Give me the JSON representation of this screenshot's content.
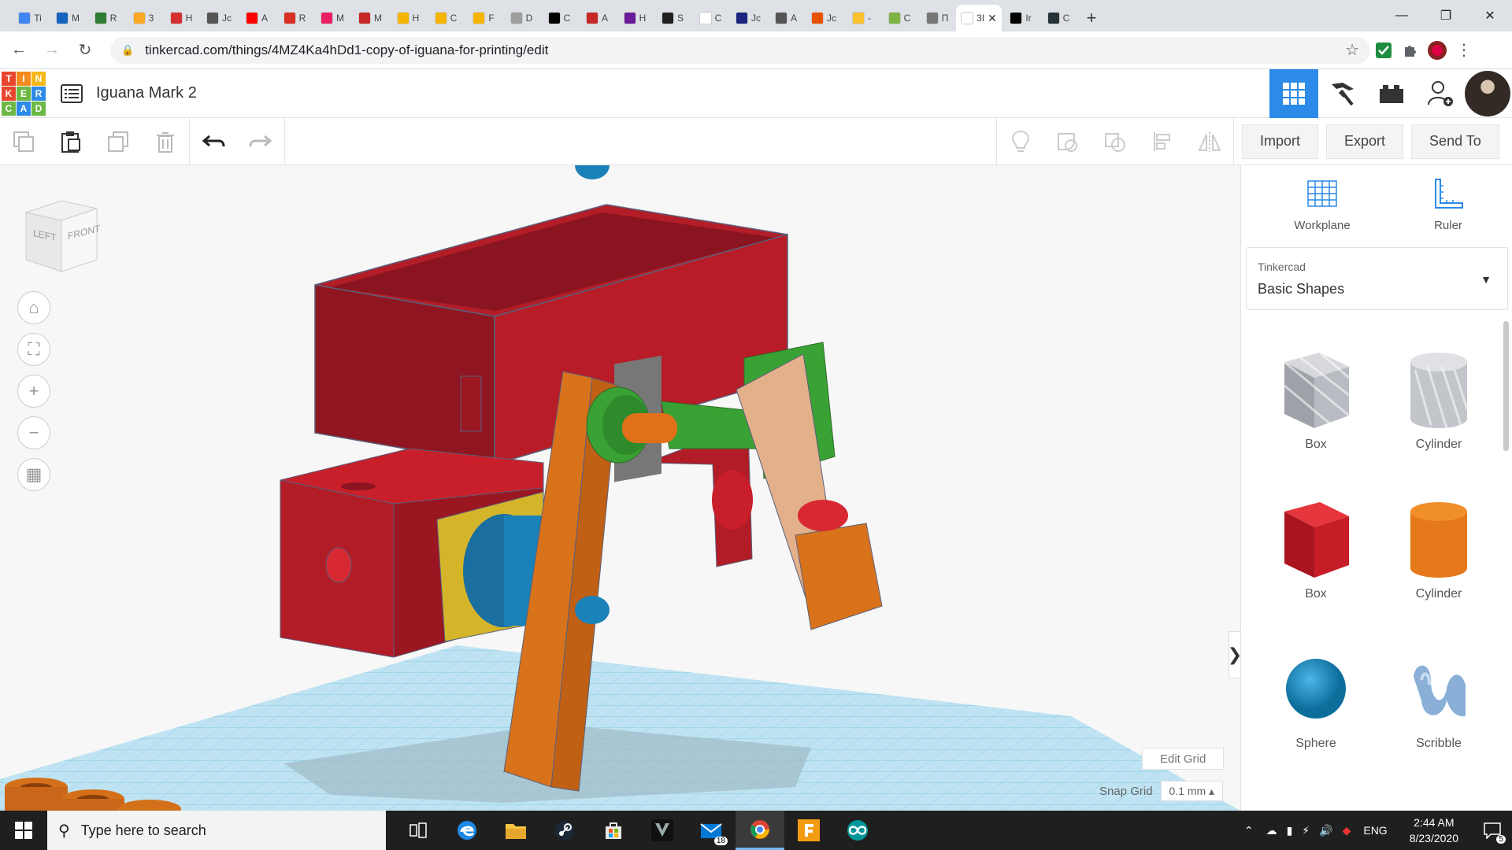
{
  "browser": {
    "tabs": [
      {
        "letter": "Ti",
        "color": "#4285f4"
      },
      {
        "letter": "M",
        "color": "#1565c0"
      },
      {
        "letter": "R",
        "color": "#2e7d32"
      },
      {
        "letter": "3",
        "color": "#f9a825"
      },
      {
        "letter": "H",
        "color": "#d32f2f"
      },
      {
        "letter": "Jc",
        "color": "#555555"
      },
      {
        "letter": "A",
        "color": "#ff0000"
      },
      {
        "letter": "R",
        "color": "#d93025"
      },
      {
        "letter": "M",
        "color": "#e91e63"
      },
      {
        "letter": "M",
        "color": "#c62828"
      },
      {
        "letter": "H",
        "color": "#f4b400"
      },
      {
        "letter": "C",
        "color": "#f4b400"
      },
      {
        "letter": "F",
        "color": "#f4b400"
      },
      {
        "letter": "D",
        "color": "#9e9e9e"
      },
      {
        "letter": "C",
        "color": "#000000"
      },
      {
        "letter": "A",
        "color": "#c62828"
      },
      {
        "letter": "H",
        "color": "#6a1b9a"
      },
      {
        "letter": "S",
        "color": "#212121"
      },
      {
        "letter": "C",
        "color": "#ffffff"
      },
      {
        "letter": "Jc",
        "color": "#1a237e"
      },
      {
        "letter": "A",
        "color": "#555555"
      },
      {
        "letter": "Jc",
        "color": "#e65100"
      },
      {
        "letter": "-",
        "color": "#fbc02d"
      },
      {
        "letter": "C",
        "color": "#7cb342"
      },
      {
        "letter": "П",
        "color": "#777777"
      },
      {
        "letter": "3I",
        "color": "#ffffff"
      },
      {
        "letter": "Ir",
        "color": "#000000"
      },
      {
        "letter": "C",
        "color": "#263238"
      }
    ],
    "active_tab_index": 25,
    "new_tab": "+",
    "url": "tinkercad.com/things/4MZ4Ka4hDd1-copy-of-iguana-for-printing/edit"
  },
  "header": {
    "logo_letters": [
      "T",
      "I",
      "N",
      "K",
      "E",
      "R",
      "C",
      "A",
      "D"
    ],
    "logo_colors": [
      "#e8462f",
      "#f38a1b",
      "#f6b81c",
      "#e8462f",
      "#6bb844",
      "#2c8ae8",
      "#6bb844",
      "#2c8ae8",
      "#6bb844"
    ],
    "design_title": "Iguana Mark 2"
  },
  "toolbar": {
    "import_label": "Import",
    "export_label": "Export",
    "send_to_label": "Send To"
  },
  "viewport": {
    "viewcube_left": "LEFT",
    "viewcube_front": "FRONT",
    "edit_grid_label": "Edit Grid",
    "snap_grid_label": "Snap Grid",
    "snap_grid_value": "0.1 mm ▴"
  },
  "panel": {
    "workplane_label": "Workplane",
    "ruler_label": "Ruler",
    "library_source": "Tinkercad",
    "library_name": "Basic Shapes",
    "shapes": [
      {
        "name": "Box",
        "color": "#b8bcc2",
        "kind": "box-hole"
      },
      {
        "name": "Cylinder",
        "color": "#b8bcc2",
        "kind": "cyl-hole"
      },
      {
        "name": "Box",
        "color": "#d8242b",
        "kind": "box"
      },
      {
        "name": "Cylinder",
        "color": "#e5791a",
        "kind": "cyl"
      },
      {
        "name": "Sphere",
        "color": "#1a8fc7",
        "kind": "sphere"
      },
      {
        "name": "Scribble",
        "color": "#8ab0d8",
        "kind": "scribble"
      }
    ]
  },
  "taskbar": {
    "search_placeholder": "Type here to search",
    "mail_badge": "18",
    "language": "ENG",
    "time": "2:44 AM",
    "date": "8/23/2020",
    "notification_count": "5"
  }
}
